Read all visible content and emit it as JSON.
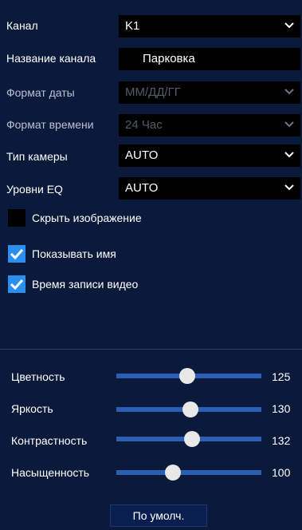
{
  "colors": {
    "background": "#0b1a3b",
    "field_bg": "#000000",
    "accent": "#2b8ff0",
    "slider_track": "#2a5fb4",
    "slider_thumb": "#e8e8e8"
  },
  "settings": {
    "channel": {
      "label": "Канал",
      "value": "K1",
      "icon": "chevron-down-icon"
    },
    "channel_name": {
      "label": "Название канала",
      "value": "Парковка"
    },
    "date_format": {
      "label": "Формат даты",
      "value": "ММ/ДД/ГГ",
      "disabled": true,
      "icon": "chevron-down-icon"
    },
    "time_format": {
      "label": "Формат времени",
      "value": "24 Час",
      "disabled": true,
      "icon": "chevron-down-icon"
    },
    "camera_type": {
      "label": "Тип камеры",
      "value": "AUTO",
      "icon": "chevron-down-icon"
    },
    "eq_level": {
      "label": "Уровни EQ",
      "value": "AUTO",
      "icon": "chevron-down-icon"
    }
  },
  "checkboxes": [
    {
      "label": "Скрыть изображение",
      "checked": false
    },
    {
      "label": "Показывать имя",
      "checked": true
    },
    {
      "label": "Время записи видео",
      "checked": true
    }
  ],
  "sliders": [
    {
      "label": "Цветность",
      "value": "125",
      "level": 0.49
    },
    {
      "label": "Яркость",
      "value": "130",
      "level": 0.51
    },
    {
      "label": "Контрастность",
      "value": "132",
      "level": 0.52
    },
    {
      "label": "Насыщенность",
      "value": "100",
      "level": 0.39
    }
  ],
  "default_button": "По умолч."
}
